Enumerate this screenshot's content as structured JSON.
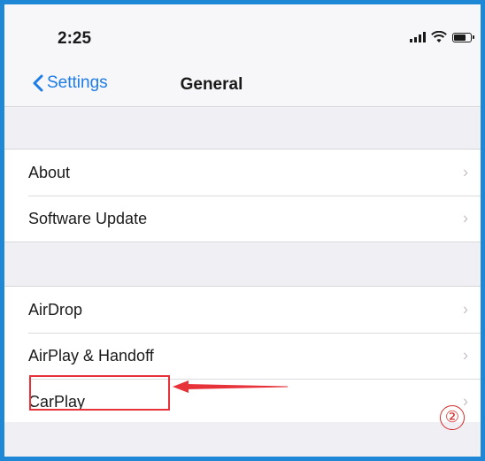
{
  "status_bar": {
    "time": "2:25",
    "icons": [
      "cellular-signal-icon",
      "wifi-icon",
      "battery-icon"
    ]
  },
  "nav_bar": {
    "back_label": "Settings",
    "title": "General"
  },
  "groups": [
    {
      "items": [
        {
          "label": "About"
        },
        {
          "label": "Software Update"
        }
      ]
    },
    {
      "items": [
        {
          "label": "AirDrop"
        },
        {
          "label": "AirPlay & Handoff"
        },
        {
          "label": "CarPlay"
        }
      ]
    }
  ],
  "annotation": {
    "step_number": "②",
    "highlighted_item": "CarPlay",
    "highlight_color": "#e8323a"
  },
  "colors": {
    "frame_border": "#1e88d6",
    "link_blue": "#1e7ce6"
  }
}
